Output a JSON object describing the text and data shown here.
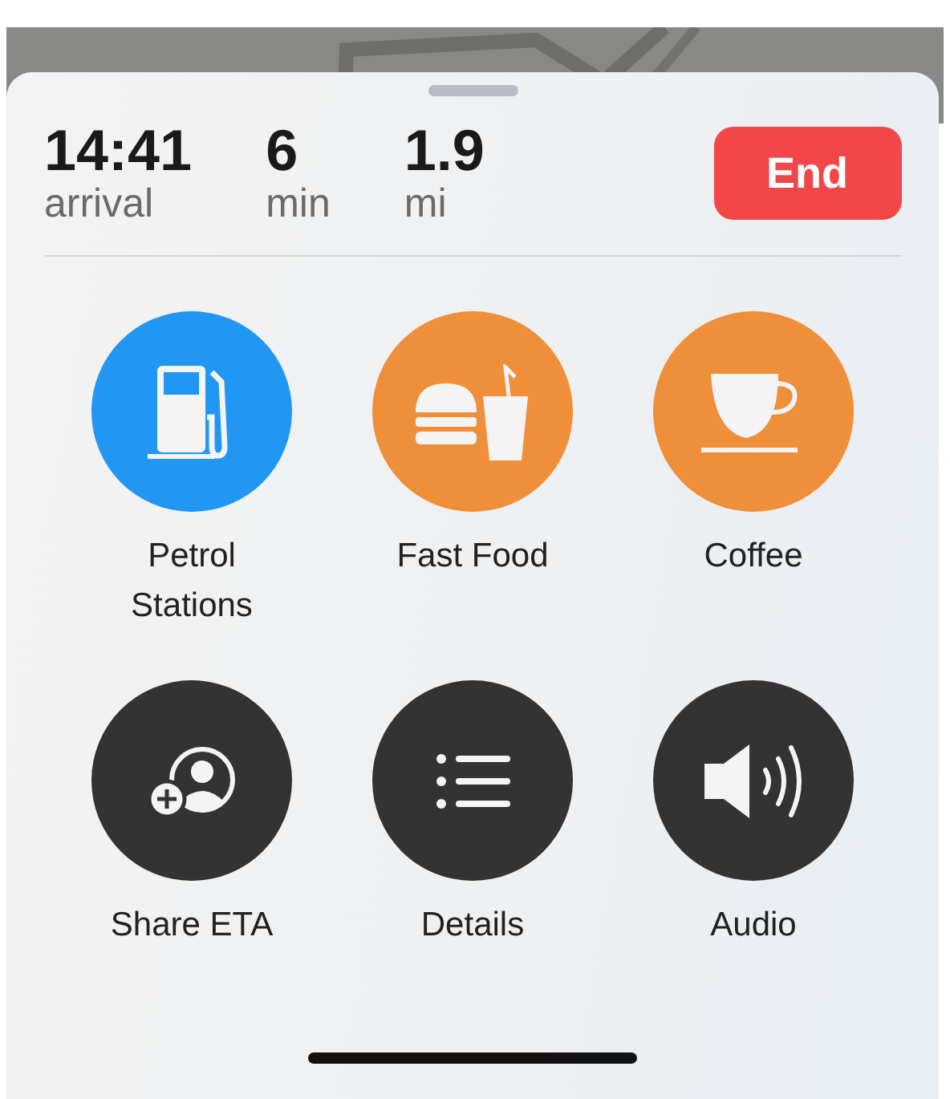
{
  "trip": [
    {
      "value": "14:41",
      "unit": "arrival"
    },
    {
      "value": "6",
      "unit": "min"
    },
    {
      "value": "1.9",
      "unit": "mi"
    }
  ],
  "end_button": "End",
  "actions": [
    {
      "label": "Petrol Stations",
      "color": "#2196f3"
    },
    {
      "label": "Fast Food",
      "color": "#ef8f3a"
    },
    {
      "label": "Coffee",
      "color": "#ef8f3a"
    },
    {
      "label": "Share ETA",
      "color": "#333333"
    },
    {
      "label": "Details",
      "color": "#333333"
    },
    {
      "label": "Audio",
      "color": "#333333"
    }
  ]
}
